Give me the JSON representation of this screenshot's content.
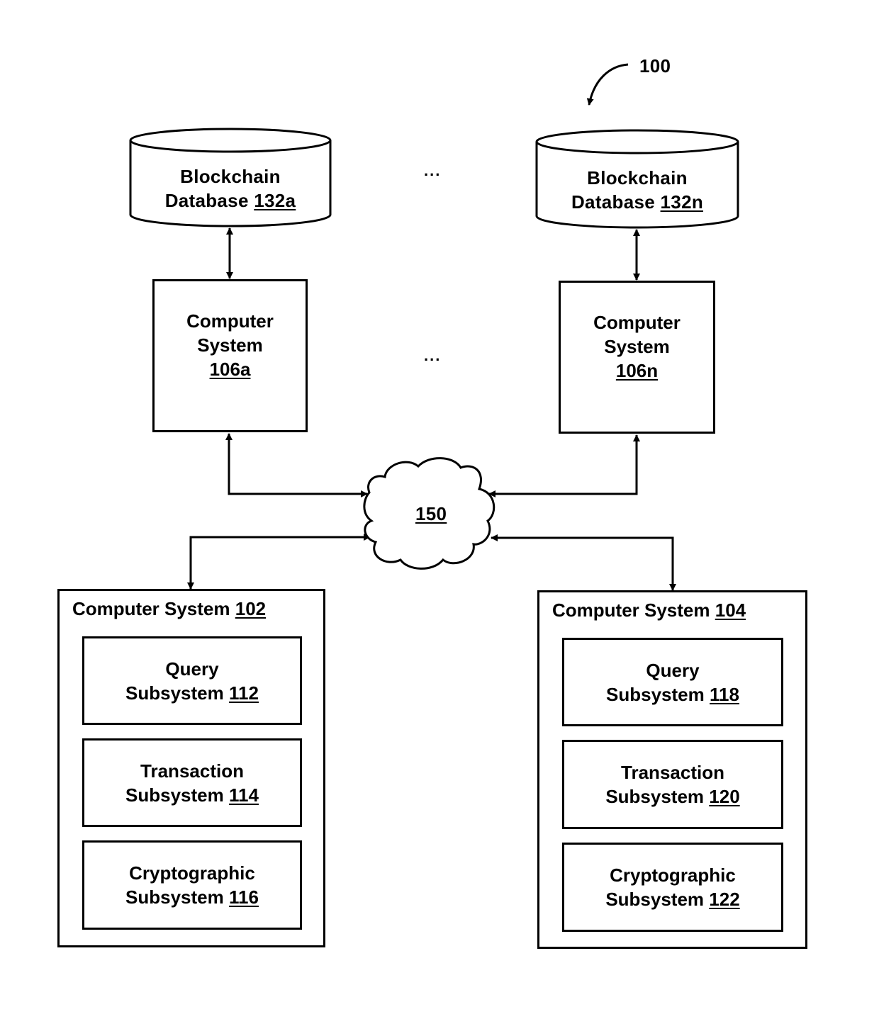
{
  "figure_ref": "100",
  "ellipsis": "...",
  "network": {
    "ref": "150"
  },
  "databases": [
    {
      "line1": "Blockchain",
      "line2": "Database",
      "ref": "132a"
    },
    {
      "line1": "Blockchain",
      "line2": "Database",
      "ref": "132n"
    }
  ],
  "nodes": [
    {
      "line1": "Computer",
      "line2": "System",
      "ref": "106a"
    },
    {
      "line1": "Computer",
      "line2": "System",
      "ref": "106n"
    }
  ],
  "systems": [
    {
      "title": "Computer System",
      "ref": "102",
      "subsystems": [
        {
          "line1": "Query",
          "line2": "Subsystem",
          "ref": "112"
        },
        {
          "line1": "Transaction",
          "line2": "Subsystem",
          "ref": "114"
        },
        {
          "line1": "Cryptographic",
          "line2": "Subsystem",
          "ref": "116"
        }
      ]
    },
    {
      "title": "Computer System",
      "ref": "104",
      "subsystems": [
        {
          "line1": "Query",
          "line2": "Subsystem",
          "ref": "118"
        },
        {
          "line1": "Transaction",
          "line2": "Subsystem",
          "ref": "120"
        },
        {
          "line1": "Cryptographic",
          "line2": "Subsystem",
          "ref": "122"
        }
      ]
    }
  ]
}
